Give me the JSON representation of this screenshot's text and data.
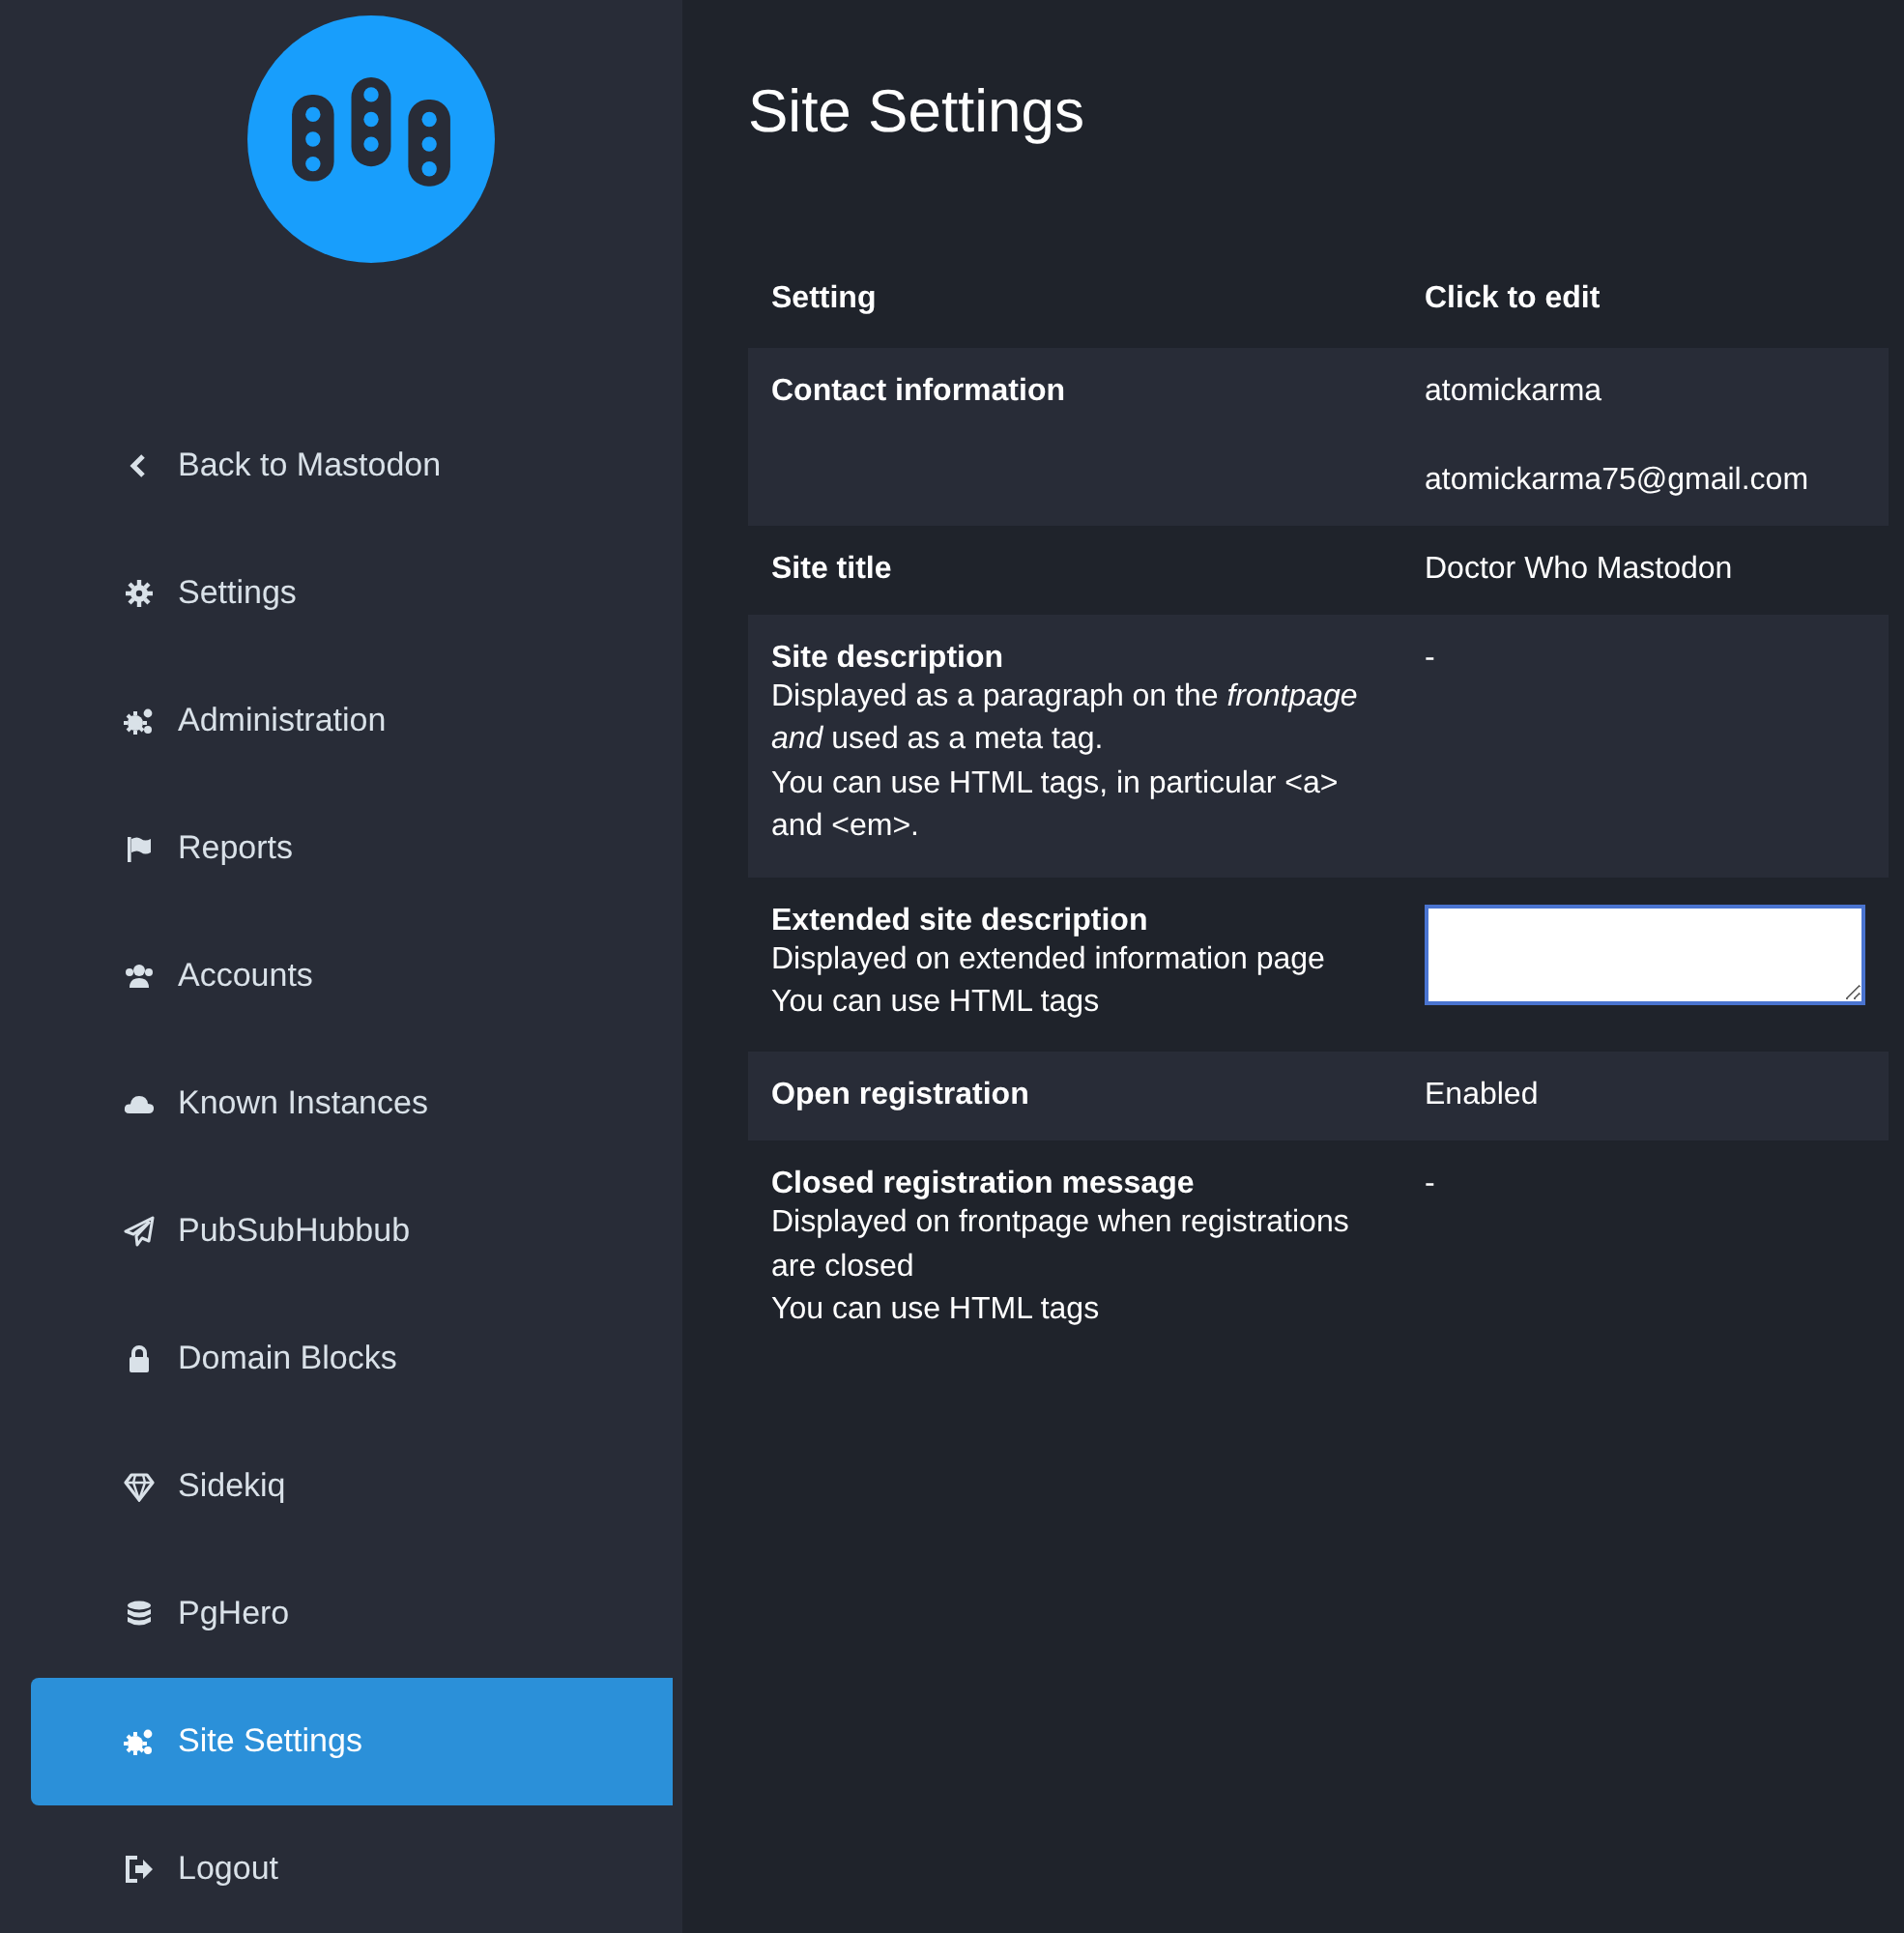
{
  "sidebar": {
    "items": [
      {
        "kind": "chevron",
        "label": "Back to Mastodon",
        "selected": false
      },
      {
        "kind": "gear",
        "label": "Settings",
        "selected": false
      },
      {
        "kind": "gears",
        "label": "Administration",
        "selected": false
      },
      {
        "kind": "flag",
        "label": "Reports",
        "selected": false
      },
      {
        "kind": "users",
        "label": "Accounts",
        "selected": false
      },
      {
        "kind": "cloud",
        "label": "Known Instances",
        "selected": false
      },
      {
        "kind": "plane",
        "label": "PubSubHubbub",
        "selected": false
      },
      {
        "kind": "lock",
        "label": "Domain Blocks",
        "selected": false
      },
      {
        "kind": "diamond",
        "label": "Sidekiq",
        "selected": false
      },
      {
        "kind": "database",
        "label": "PgHero",
        "selected": false
      },
      {
        "kind": "gears",
        "label": "Site Settings",
        "selected": true
      },
      {
        "kind": "logout",
        "label": "Logout",
        "selected": false
      }
    ]
  },
  "page_title": "Site Settings",
  "table": {
    "columns": [
      "Setting",
      "Click to edit"
    ],
    "rows": [
      {
        "label": "Contact information",
        "hint": [],
        "kind": "text",
        "values": [
          "atomickarma",
          "atomickarma75@gmail.com"
        ]
      },
      {
        "label": "Site title",
        "hint": [],
        "kind": "text",
        "values": [
          "Doctor Who Mastodon"
        ]
      },
      {
        "label": "Site description",
        "hint": [
          "Displayed as a paragraph on the *frontpage and* used as a meta tag.",
          "You can use HTML tags, in particular <a> and <em>."
        ],
        "kind": "text",
        "values": [
          "-"
        ]
      },
      {
        "label": "Extended site description",
        "hint": [
          "Displayed on extended information page",
          "You can use HTML tags"
        ],
        "kind": "textarea",
        "values": []
      },
      {
        "label": "Open registration",
        "hint": [],
        "kind": "text",
        "values": [
          "Enabled"
        ]
      },
      {
        "label": "Closed registration message",
        "hint": [
          "Displayed on frontpage when registrations are closed",
          "You can use HTML tags"
        ],
        "kind": "text",
        "values": [
          "-"
        ]
      }
    ]
  }
}
